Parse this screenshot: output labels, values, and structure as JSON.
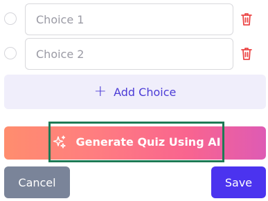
{
  "choices": [
    {
      "placeholder": "Choice 1",
      "value": ""
    },
    {
      "placeholder": "Choice 2",
      "value": ""
    }
  ],
  "add_choice": {
    "label": "Add Choice",
    "icon": "plus-icon"
  },
  "generate": {
    "label": "Generate Quiz Using AI",
    "icon": "sparkles-icon"
  },
  "actions": {
    "cancel_label": "Cancel",
    "save_label": "Save"
  },
  "colors": {
    "accent": "#4b33ef",
    "delete_icon": "#ec4747",
    "cancel_bg": "#7a8499",
    "add_choice_bg": "#f0eefb",
    "highlight_border": "#1e7a55"
  }
}
